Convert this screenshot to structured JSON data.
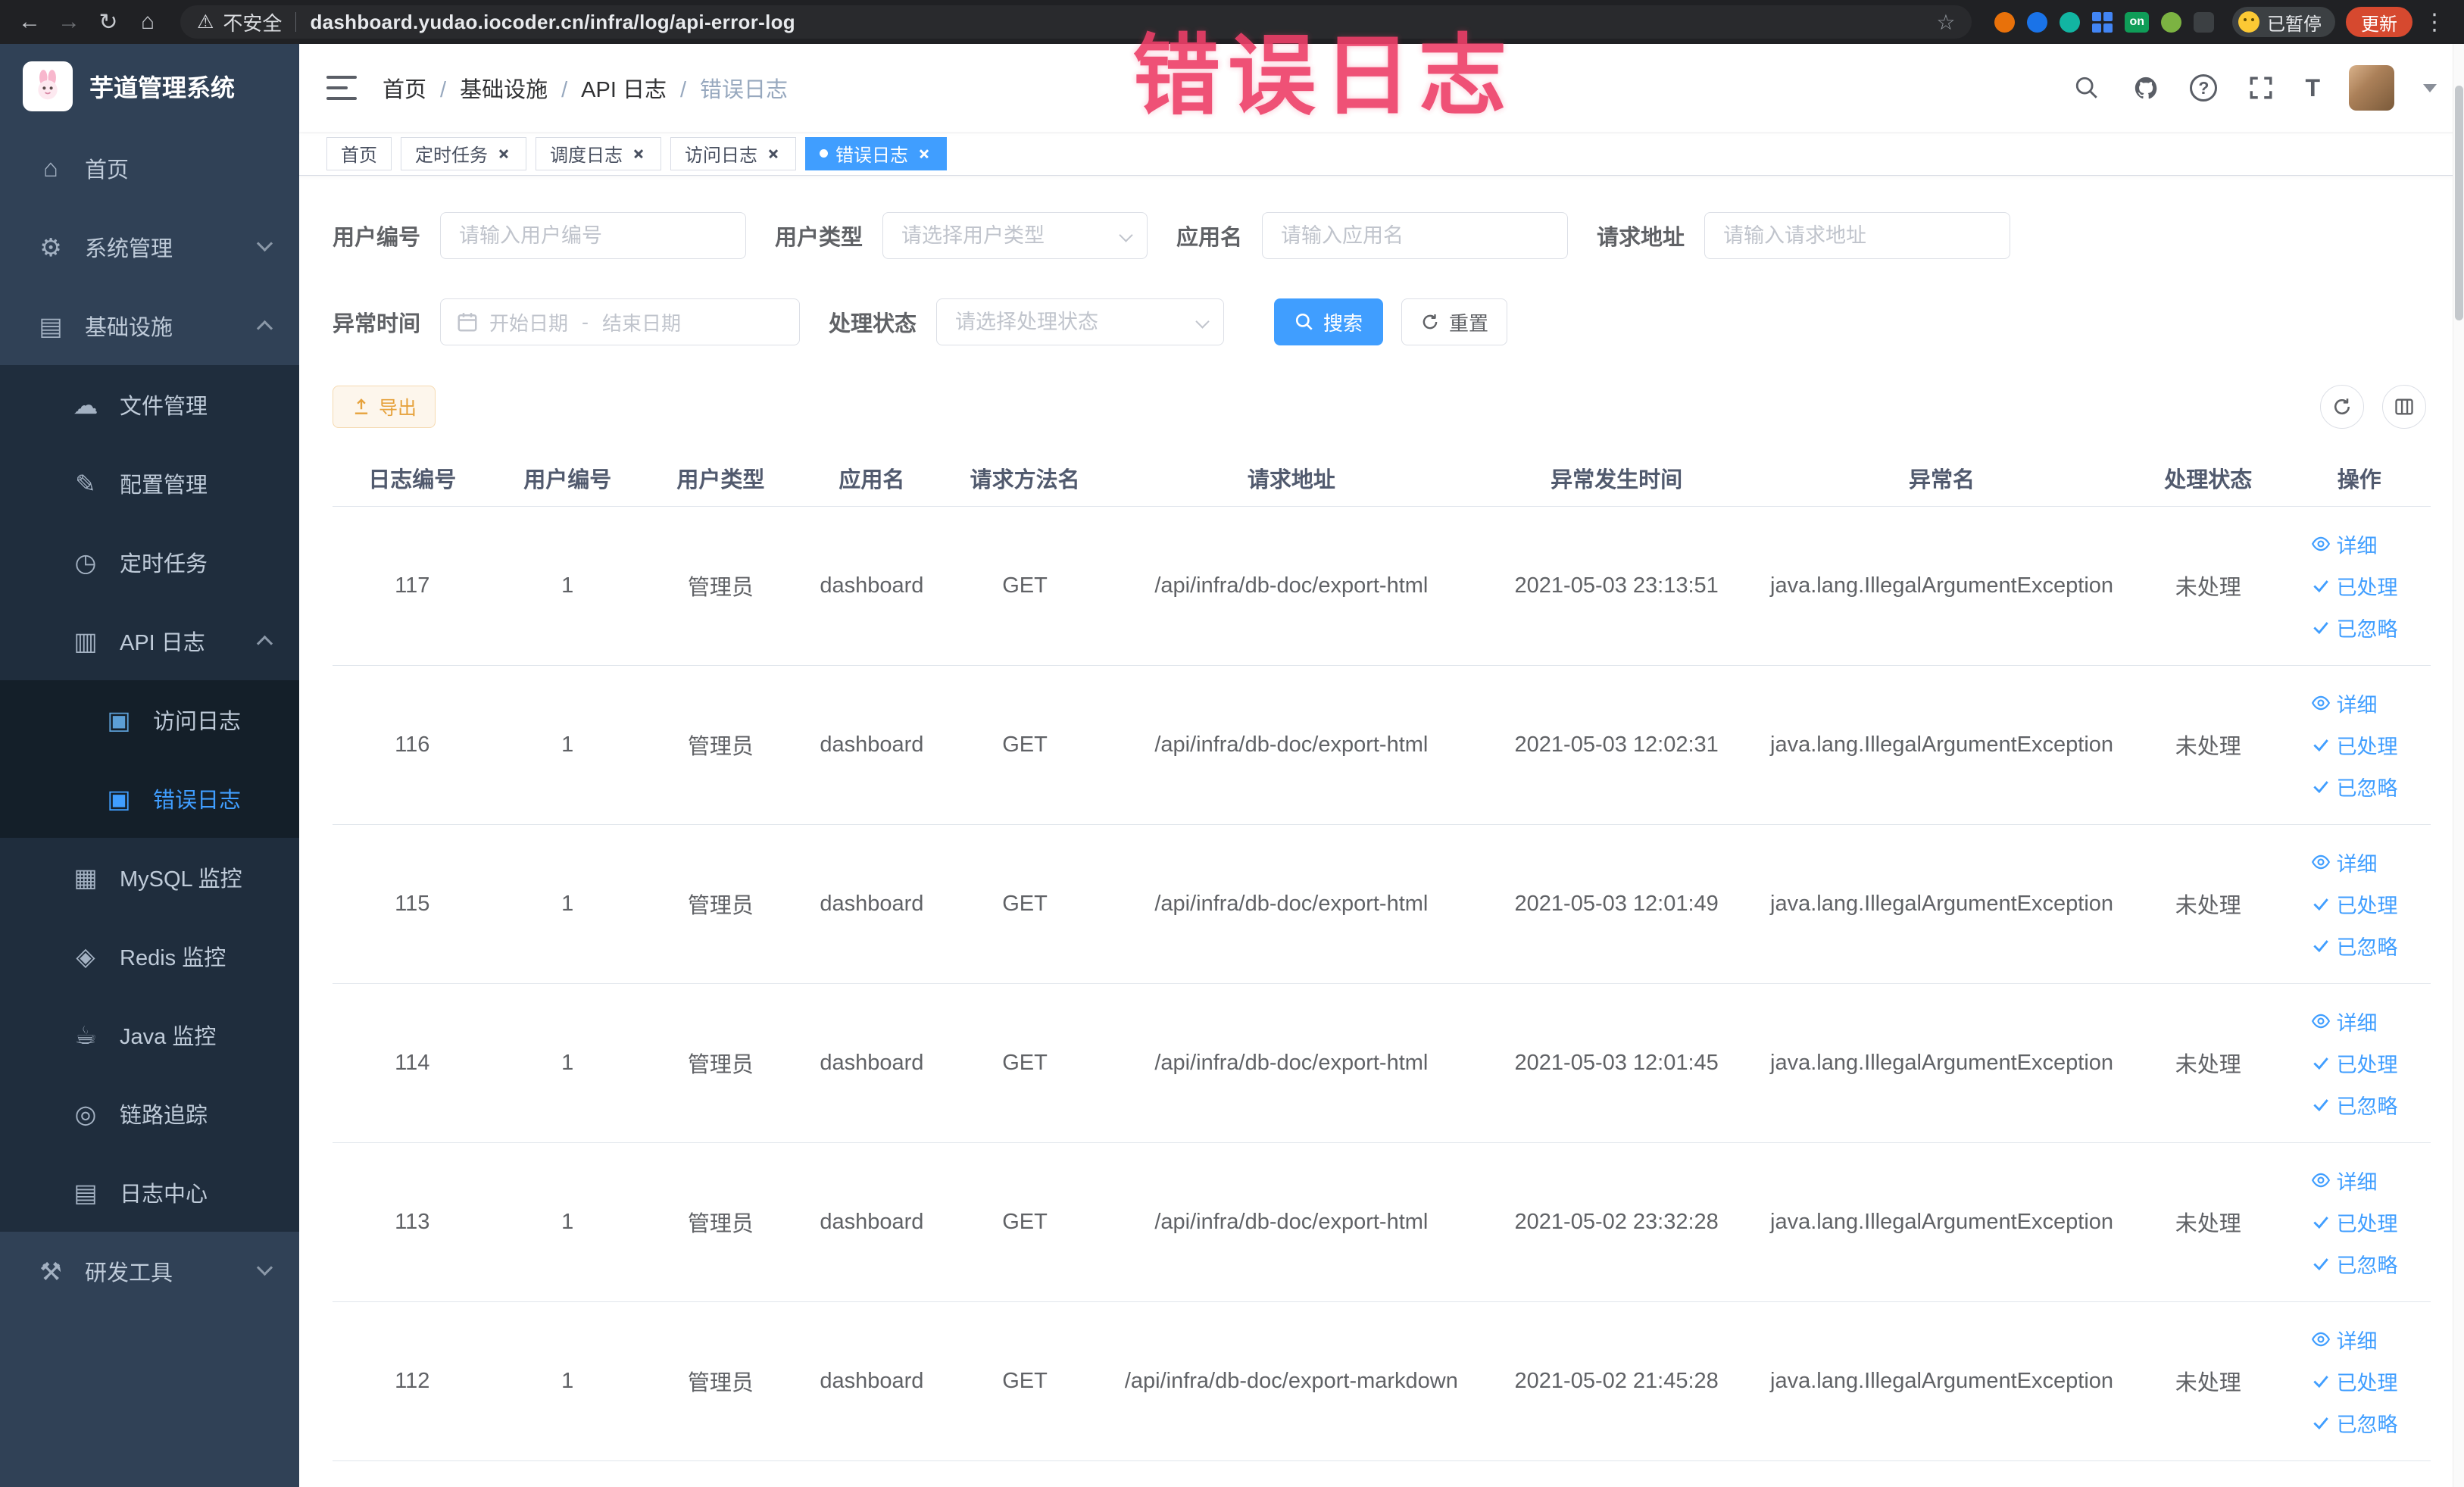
{
  "theme": {
    "primary": "#409eff",
    "warning": "#e6a23c",
    "watermark": "#ee3f68"
  },
  "browser": {
    "warning_label": "不安全",
    "url": "dashboard.yudao.iocoder.cn/infra/log/api-error-log",
    "ext_on_label": "on",
    "paused_badge": "已暂停",
    "update_label": "更新"
  },
  "annotation": {
    "watermark": "错误日志"
  },
  "sidebar": {
    "logo_title": "芋道管理系统",
    "items": [
      {
        "label": "首页",
        "icon": "home-icon",
        "level": 0,
        "arrowDown": false,
        "arrowUp": false,
        "active": false
      },
      {
        "label": "系统管理",
        "icon": "gear-icon",
        "level": 0,
        "arrowDown": true,
        "arrowUp": false,
        "active": false
      },
      {
        "label": "基础设施",
        "icon": "infrastructure-icon",
        "level": 0,
        "arrowDown": false,
        "arrowUp": true,
        "active": false
      },
      {
        "label": "文件管理",
        "icon": "file-icon",
        "level": 1,
        "arrowDown": false,
        "arrowUp": false,
        "active": false
      },
      {
        "label": "配置管理",
        "icon": "config-icon",
        "level": 1,
        "arrowDown": false,
        "arrowUp": false,
        "active": false
      },
      {
        "label": "定时任务",
        "icon": "timer-icon",
        "level": 1,
        "arrowDown": false,
        "arrowUp": false,
        "active": false
      },
      {
        "label": "API 日志",
        "icon": "api-log-icon",
        "level": 1,
        "arrowDown": false,
        "arrowUp": true,
        "active": false
      },
      {
        "label": "访问日志",
        "icon": "doc-icon",
        "level": 2,
        "arrowDown": false,
        "arrowUp": false,
        "active": false
      },
      {
        "label": "错误日志",
        "icon": "doc-icon",
        "level": 2,
        "arrowDown": false,
        "arrowUp": false,
        "active": true
      },
      {
        "label": "MySQL 监控",
        "icon": "mysql-icon",
        "level": 1,
        "arrowDown": false,
        "arrowUp": false,
        "active": false
      },
      {
        "label": "Redis 监控",
        "icon": "redis-icon",
        "level": 1,
        "arrowDown": false,
        "arrowUp": false,
        "active": false
      },
      {
        "label": "Java 监控",
        "icon": "java-icon",
        "level": 1,
        "arrowDown": false,
        "arrowUp": false,
        "active": false
      },
      {
        "label": "链路追踪",
        "icon": "trace-icon",
        "level": 1,
        "arrowDown": false,
        "arrowUp": false,
        "active": false
      },
      {
        "label": "日志中心",
        "icon": "logcenter-icon",
        "level": 1,
        "arrowDown": false,
        "arrowUp": false,
        "active": false
      },
      {
        "label": "研发工具",
        "icon": "devtools-icon",
        "level": 0,
        "arrowDown": true,
        "arrowUp": false,
        "active": false
      }
    ]
  },
  "header": {
    "breadcrumb": [
      {
        "label": "首页",
        "current": false
      },
      {
        "label": "基础设施",
        "current": false
      },
      {
        "label": "API 日志",
        "current": false
      },
      {
        "label": "错误日志",
        "current": true
      }
    ]
  },
  "tabs": [
    {
      "label": "首页",
      "closable": false,
      "active": false
    },
    {
      "label": "定时任务",
      "closable": true,
      "active": false
    },
    {
      "label": "调度日志",
      "closable": true,
      "active": false
    },
    {
      "label": "访问日志",
      "closable": true,
      "active": false
    },
    {
      "label": "错误日志",
      "closable": true,
      "active": true
    }
  ],
  "filters": {
    "user_id": {
      "label": "用户编号",
      "placeholder": "请输入用户编号"
    },
    "user_type": {
      "label": "用户类型",
      "placeholder": "请选择用户类型"
    },
    "app_name": {
      "label": "应用名",
      "placeholder": "请输入应用名"
    },
    "request_url": {
      "label": "请求地址",
      "placeholder": "请输入请求地址"
    },
    "exception_time": {
      "label": "异常时间",
      "start_placeholder": "开始日期",
      "separator": "-",
      "end_placeholder": "结束日期"
    },
    "process_status": {
      "label": "处理状态",
      "placeholder": "请选择处理状态"
    },
    "search_label": "搜索",
    "reset_label": "重置"
  },
  "toolbar": {
    "export_label": "导出"
  },
  "table": {
    "columns": [
      "日志编号",
      "用户编号",
      "用户类型",
      "应用名",
      "请求方法名",
      "请求地址",
      "异常发生时间",
      "异常名",
      "处理状态",
      "操作"
    ],
    "actions": [
      "详细",
      "已处理",
      "已忽略"
    ],
    "rows": [
      {
        "id": "117",
        "user_id": "1",
        "user_type": "管理员",
        "app": "dashboard",
        "method": "GET",
        "url": "/api/infra/db-doc/export-html",
        "time": "2021-05-03 23:13:51",
        "exception": "java.lang.IllegalArgumentException",
        "status": "未处理"
      },
      {
        "id": "116",
        "user_id": "1",
        "user_type": "管理员",
        "app": "dashboard",
        "method": "GET",
        "url": "/api/infra/db-doc/export-html",
        "time": "2021-05-03 12:02:31",
        "exception": "java.lang.IllegalArgumentException",
        "status": "未处理"
      },
      {
        "id": "115",
        "user_id": "1",
        "user_type": "管理员",
        "app": "dashboard",
        "method": "GET",
        "url": "/api/infra/db-doc/export-html",
        "time": "2021-05-03 12:01:49",
        "exception": "java.lang.IllegalArgumentException",
        "status": "未处理"
      },
      {
        "id": "114",
        "user_id": "1",
        "user_type": "管理员",
        "app": "dashboard",
        "method": "GET",
        "url": "/api/infra/db-doc/export-html",
        "time": "2021-05-03 12:01:45",
        "exception": "java.lang.IllegalArgumentException",
        "status": "未处理"
      },
      {
        "id": "113",
        "user_id": "1",
        "user_type": "管理员",
        "app": "dashboard",
        "method": "GET",
        "url": "/api/infra/db-doc/export-html",
        "time": "2021-05-02 23:32:28",
        "exception": "java.lang.IllegalArgumentException",
        "status": "未处理"
      },
      {
        "id": "112",
        "user_id": "1",
        "user_type": "管理员",
        "app": "dashboard",
        "method": "GET",
        "url": "/api/infra/db-doc/export-markdown",
        "time": "2021-05-02 21:45:28",
        "exception": "java.lang.IllegalArgumentException",
        "status": "未处理"
      }
    ]
  }
}
